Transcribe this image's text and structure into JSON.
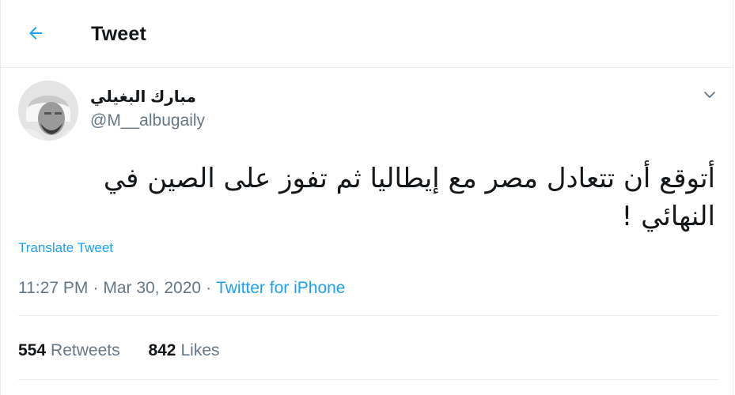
{
  "header": {
    "title": "Tweet",
    "back_icon": "arrow-left-icon"
  },
  "author": {
    "display_name": "مبارك البغيلي",
    "handle": "@M__albugaily",
    "avatar": "avatar-photo"
  },
  "tweet": {
    "text": "أتوقع أن تتعادل مصر مع إيطاليا ثم تفوز على الصين في النهائي !",
    "translate_label": "Translate Tweet",
    "time": "11:27 PM",
    "separator": "·",
    "date": "Mar 30, 2020",
    "source": "Twitter for iPhone"
  },
  "stats": {
    "retweets_count": "554",
    "retweets_label": "Retweets",
    "likes_count": "842",
    "likes_label": "Likes"
  },
  "colors": {
    "accent": "#1da1f2",
    "text_primary": "#14171a",
    "text_secondary": "#657786",
    "border": "#e6ecf0"
  }
}
